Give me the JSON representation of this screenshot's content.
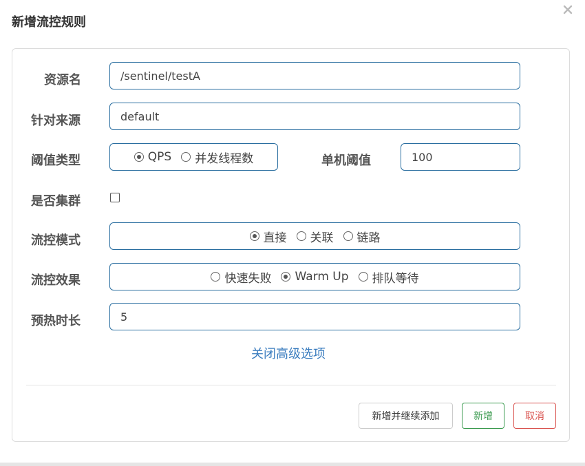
{
  "dialog": {
    "title": "新增流控规则",
    "close_icon": "close-icon"
  },
  "form": {
    "resource": {
      "label": "资源名",
      "value": "/sentinel/testA"
    },
    "limit_app": {
      "label": "针对来源",
      "value": "default"
    },
    "threshold_type": {
      "label": "阈值类型",
      "options": [
        {
          "label": "QPS",
          "checked": true
        },
        {
          "label": "并发线程数",
          "checked": false
        }
      ]
    },
    "single_threshold": {
      "label": "单机阈值",
      "value": "100"
    },
    "cluster": {
      "label": "是否集群",
      "checked": false
    },
    "strategy": {
      "label": "流控模式",
      "options": [
        {
          "label": "直接",
          "checked": true
        },
        {
          "label": "关联",
          "checked": false
        },
        {
          "label": "链路",
          "checked": false
        }
      ]
    },
    "control_behavior": {
      "label": "流控效果",
      "options": [
        {
          "label": "快速失败",
          "checked": false
        },
        {
          "label": "Warm Up",
          "checked": true
        },
        {
          "label": "排队等待",
          "checked": false
        }
      ]
    },
    "warmup_period": {
      "label": "预热时长",
      "value": "5"
    },
    "advanced_toggle": "关闭高级选项"
  },
  "footer": {
    "add_continue_label": "新增并继续添加",
    "add_label": "新增",
    "cancel_label": "取消"
  }
}
